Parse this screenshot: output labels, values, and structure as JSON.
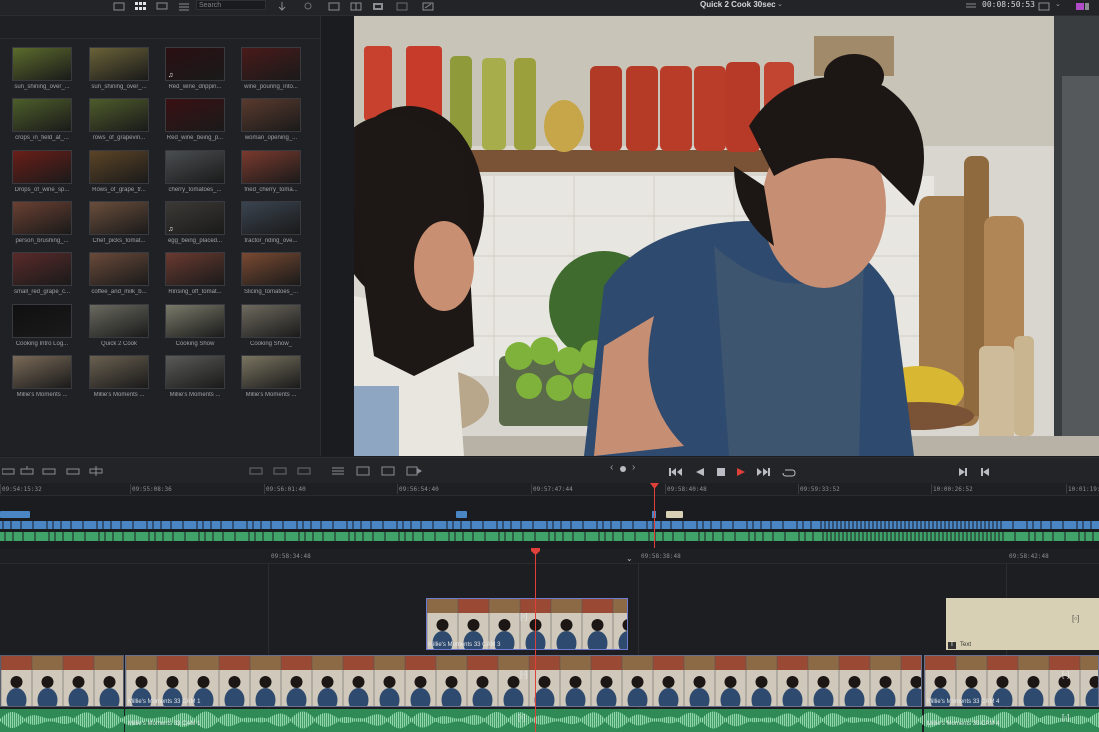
{
  "topbar": {
    "search_placeholder": "Search",
    "timeline_name": "Quick 2 Cook 30sec",
    "timecode": "00:08:50:53"
  },
  "media_pool": {
    "clips": [
      {
        "label": "sun_shining_over_...",
        "color": "#5b6b2c"
      },
      {
        "label": "sun_shining_over_...",
        "color": "#6a6238"
      },
      {
        "label": "Red_wine_drippin...",
        "color": "#2a0f12",
        "audio": true
      },
      {
        "label": "wine_pouring_into...",
        "color": "#4a1a1a"
      },
      {
        "label": "crops_in_field_at_...",
        "color": "#4d5e2a"
      },
      {
        "label": "rows_of_grapevin...",
        "color": "#4e5c2b"
      },
      {
        "label": "Red_wine_being_p...",
        "color": "#3a1013"
      },
      {
        "label": "woman_opening_...",
        "color": "#5a3a2e"
      },
      {
        "label": "Drops_of_wine_sp...",
        "color": "#6a1e18"
      },
      {
        "label": "Rows_of_grape_tr...",
        "color": "#5c4426"
      },
      {
        "label": "cherry_tomatoes_...",
        "color": "#4a4e50"
      },
      {
        "label": "fried_cherry_toma...",
        "color": "#7a3a2e"
      },
      {
        "label": "person_brushing_...",
        "color": "#6a4032"
      },
      {
        "label": "Chef_picks_tomat...",
        "color": "#6a4e3c"
      },
      {
        "label": "egg_being_placed...",
        "color": "#3c3a36",
        "audio": true
      },
      {
        "label": "tractor_riding_ove...",
        "color": "#3a4450"
      },
      {
        "label": "small_red_grape_c...",
        "color": "#5a2a2a"
      },
      {
        "label": "coffee_and_milk_b...",
        "color": "#6a4a3a"
      },
      {
        "label": "Rinsing_off_tomat...",
        "color": "#6a3a30"
      },
      {
        "label": "Slicing_tomatoes_...",
        "color": "#7a4a32"
      },
      {
        "label": "Cooking Intro Log...",
        "color": "#101010"
      },
      {
        "label": "Quick 2 Cook",
        "color": "#6a6a60"
      },
      {
        "label": "Cooking Show",
        "color": "#7a7a6a"
      },
      {
        "label": "Cooking Show_",
        "color": "#6e6a5e"
      },
      {
        "label": "Millie's Moments ...",
        "color": "#7a6a58"
      },
      {
        "label": "Millie's Moments ...",
        "color": "#6a6050"
      },
      {
        "label": "Millie's Moments ...",
        "color": "#5a5a58"
      },
      {
        "label": "Millie's Moments ...",
        "color": "#7a7460"
      }
    ]
  },
  "upper_ruler": {
    "labels": [
      "09:54:15:32",
      "09:55:08:36",
      "09:56:01:40",
      "09:56:54:40",
      "09:57:47:44",
      "09:58:40:48",
      "09:59:33:52",
      "10:00:26:52",
      "10:01:19:56"
    ]
  },
  "lower_ruler": {
    "labels": [
      "09:58:34:48",
      "09:58:38:48",
      "09:58:42:48"
    ]
  },
  "clips": {
    "upper_v2": "Millie's Moments 33 CAM 3",
    "text_clip": "Text",
    "v1_a": "Millie's Moments 33 CAM 1",
    "v1_b": "Millie's Moments 33 CAM 4",
    "a1_a": "Millie's Moments 33 CAM 1",
    "a1_b": "Millie's Moments 33 CAM 4"
  },
  "colors": {
    "playhead": "#e0403a",
    "video_track": "#4a86c4",
    "audio_track": "#3fa36a",
    "accent": "#e0403a"
  }
}
